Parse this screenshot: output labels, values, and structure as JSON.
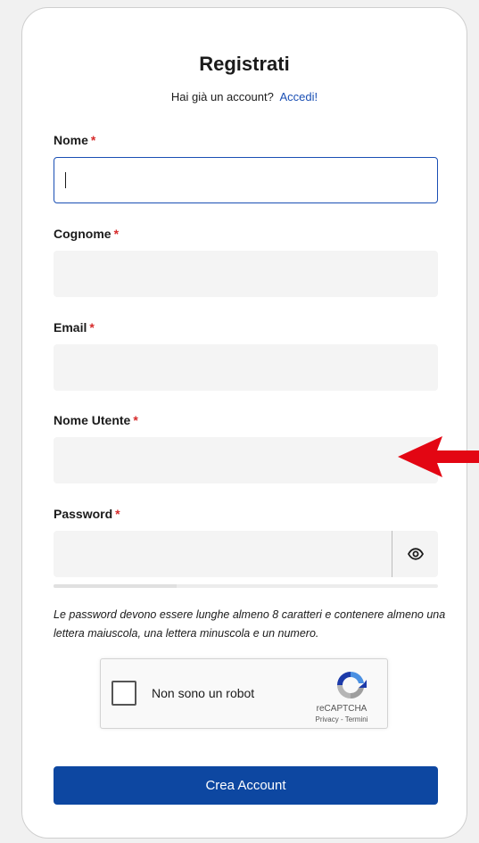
{
  "form": {
    "title": "Registrati",
    "have_account": "Hai già un account?",
    "login_link": "Accedi!",
    "required_mark": "*",
    "fields": {
      "first_name": {
        "label": "Nome",
        "value": "",
        "placeholder": ""
      },
      "last_name": {
        "label": "Cognome",
        "value": "",
        "placeholder": ""
      },
      "email": {
        "label": "Email",
        "value": "",
        "placeholder": ""
      },
      "username": {
        "label": "Nome Utente",
        "value": "",
        "placeholder": ""
      },
      "password": {
        "label": "Password",
        "value": "",
        "placeholder": "",
        "strength": 0.32
      }
    },
    "password_hint": "Le password devono essere lunghe almeno 8 caratteri e contenere almeno una lettera maiuscola, una lettera minuscola e un numero.",
    "captcha": {
      "label": "Non sono un robot",
      "brand": "reCAPTCHA",
      "terms": "Privacy - Termini"
    },
    "submit_label": "Crea Account"
  },
  "icons": {
    "password_toggle": "eye-icon",
    "captcha_logo": "recaptcha-logo-icon",
    "annotation": "red-arrow-icon"
  },
  "colors": {
    "accent": "#1a4fb4",
    "button": "#0d47a1",
    "required": "#d62b2b",
    "annotation": "#e30613"
  }
}
